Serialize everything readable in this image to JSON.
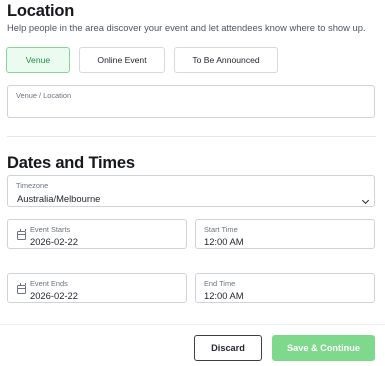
{
  "location": {
    "heading": "Location",
    "description": "Help people in the area discover your event and let attendees know where to show up.",
    "options": [
      "Venue",
      "Online Event",
      "To Be Announced"
    ],
    "selected": "Venue",
    "venue_label": "Venue / Location",
    "venue_value": ""
  },
  "dates": {
    "heading": "Dates and Times",
    "timezone_label": "Timezone",
    "timezone_value": "Australia/Melbourne",
    "event_starts_label": "Event Starts",
    "event_starts_value": "2026-02-22",
    "start_time_label": "Start Time",
    "start_time_value": "12:00 AM",
    "event_ends_label": "Event Ends",
    "event_ends_value": "2026-02-22",
    "end_time_label": "End Time",
    "end_time_value": "12:00 AM"
  },
  "actions": {
    "discard_label": "Discard",
    "save_label": "Save & Continue"
  },
  "colors": {
    "accent_green": "#7fd98c",
    "selected_bg": "#ecfbef",
    "selected_text": "#1f8f42"
  },
  "icons": [
    "calendar-icon",
    "chevron-down-icon"
  ]
}
